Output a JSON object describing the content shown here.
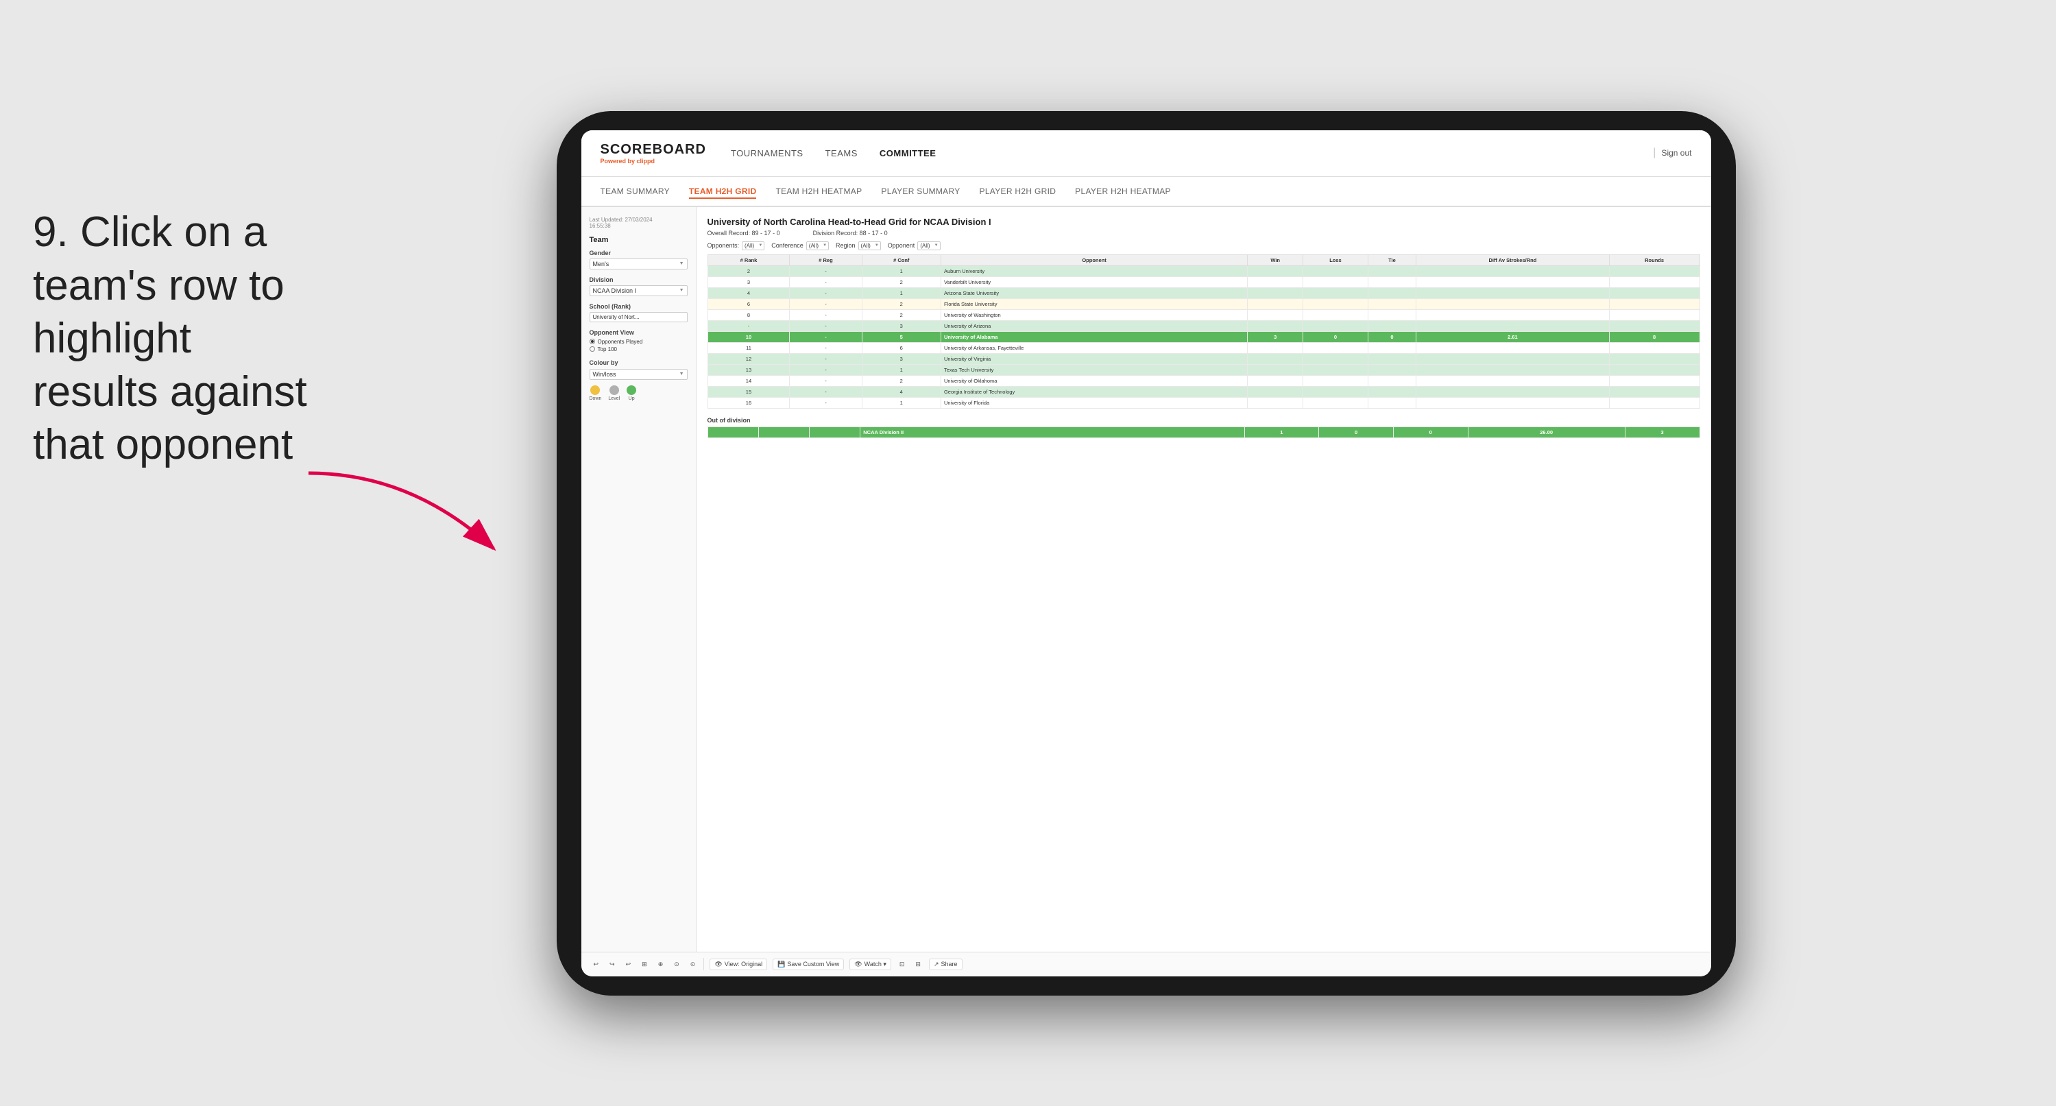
{
  "instruction": {
    "step": "9.",
    "text": "Click on a team's row to highlight results against that opponent"
  },
  "nav": {
    "logo": "SCOREBOARD",
    "powered_by": "Powered by",
    "brand": "clippd",
    "links": [
      "TOURNAMENTS",
      "TEAMS",
      "COMMITTEE"
    ],
    "active_link": "COMMITTEE",
    "sign_out": "Sign out"
  },
  "sub_nav": {
    "links": [
      "TEAM SUMMARY",
      "TEAM H2H GRID",
      "TEAM H2H HEATMAP",
      "PLAYER SUMMARY",
      "PLAYER H2H GRID",
      "PLAYER H2H HEATMAP"
    ],
    "active": "TEAM H2H GRID"
  },
  "sidebar": {
    "last_updated_label": "Last Updated: 27/03/2024",
    "last_updated_time": "16:55:38",
    "team_label": "Team",
    "gender_label": "Gender",
    "gender_value": "Men's",
    "division_label": "Division",
    "division_value": "NCAA Division I",
    "school_label": "School (Rank)",
    "school_value": "University of Nort...",
    "opponent_view_label": "Opponent View",
    "opponent_options": [
      "Opponents Played",
      "Top 100"
    ],
    "opponent_selected": "Opponents Played",
    "colour_by_label": "Colour by",
    "colour_by_value": "Win/loss",
    "legend": [
      {
        "label": "Down",
        "color": "#f0c040"
      },
      {
        "label": "Level",
        "color": "#b0b0b0"
      },
      {
        "label": "Up",
        "color": "#5cb85c"
      }
    ]
  },
  "grid": {
    "title": "University of North Carolina Head-to-Head Grid for NCAA Division I",
    "overall_record_label": "Overall Record:",
    "overall_record": "89 - 17 - 0",
    "division_record_label": "Division Record:",
    "division_record": "88 - 17 - 0",
    "filters": {
      "opponents_label": "Opponents:",
      "opponents_value": "(All)",
      "conference_label": "Conference",
      "conference_value": "(All)",
      "region_label": "Region",
      "region_value": "(All)",
      "opponent_label": "Opponent",
      "opponent_value": "(All)"
    },
    "columns": [
      "# Rank",
      "# Reg",
      "# Conf",
      "Opponent",
      "Win",
      "Loss",
      "Tie",
      "Diff Av Strokes/Rnd",
      "Rounds"
    ],
    "rows": [
      {
        "rank": "2",
        "reg": "-",
        "conf": "1",
        "opponent": "Auburn University",
        "win": "",
        "loss": "",
        "tie": "",
        "diff": "",
        "rounds": "",
        "color": "light-green"
      },
      {
        "rank": "3",
        "reg": "-",
        "conf": "2",
        "opponent": "Vanderbilt University",
        "win": "",
        "loss": "",
        "tie": "",
        "diff": "",
        "rounds": "",
        "color": ""
      },
      {
        "rank": "4",
        "reg": "-",
        "conf": "1",
        "opponent": "Arizona State University",
        "win": "",
        "loss": "",
        "tie": "",
        "diff": "",
        "rounds": "",
        "color": "light-green"
      },
      {
        "rank": "6",
        "reg": "-",
        "conf": "2",
        "opponent": "Florida State University",
        "win": "",
        "loss": "",
        "tie": "",
        "diff": "",
        "rounds": "",
        "color": "light-yellow"
      },
      {
        "rank": "8",
        "reg": "-",
        "conf": "2",
        "opponent": "University of Washington",
        "win": "",
        "loss": "",
        "tie": "",
        "diff": "",
        "rounds": "",
        "color": ""
      },
      {
        "rank": "-",
        "reg": "-",
        "conf": "3",
        "opponent": "University of Arizona",
        "win": "",
        "loss": "",
        "tie": "",
        "diff": "",
        "rounds": "",
        "color": "light-green"
      },
      {
        "rank": "10",
        "reg": "-",
        "conf": "5",
        "opponent": "University of Alabama",
        "win": "3",
        "loss": "0",
        "tie": "0",
        "diff": "2.61",
        "rounds": "8",
        "color": "highlighted"
      },
      {
        "rank": "11",
        "reg": "-",
        "conf": "6",
        "opponent": "University of Arkansas, Fayetteville",
        "win": "",
        "loss": "",
        "tie": "",
        "diff": "",
        "rounds": "",
        "color": ""
      },
      {
        "rank": "12",
        "reg": "-",
        "conf": "3",
        "opponent": "University of Virginia",
        "win": "",
        "loss": "",
        "tie": "",
        "diff": "",
        "rounds": "",
        "color": "light-green"
      },
      {
        "rank": "13",
        "reg": "-",
        "conf": "1",
        "opponent": "Texas Tech University",
        "win": "",
        "loss": "",
        "tie": "",
        "diff": "",
        "rounds": "",
        "color": "light-green"
      },
      {
        "rank": "14",
        "reg": "-",
        "conf": "2",
        "opponent": "University of Oklahoma",
        "win": "",
        "loss": "",
        "tie": "",
        "diff": "",
        "rounds": "",
        "color": ""
      },
      {
        "rank": "15",
        "reg": "-",
        "conf": "4",
        "opponent": "Georgia Institute of Technology",
        "win": "",
        "loss": "",
        "tie": "",
        "diff": "",
        "rounds": "",
        "color": "light-green"
      },
      {
        "rank": "16",
        "reg": "-",
        "conf": "1",
        "opponent": "University of Florida",
        "win": "",
        "loss": "",
        "tie": "",
        "diff": "",
        "rounds": "",
        "color": ""
      }
    ],
    "out_of_division_label": "Out of division",
    "out_of_division_row": {
      "division": "NCAA Division II",
      "win": "1",
      "loss": "0",
      "tie": "0",
      "diff": "26.00",
      "rounds": "3"
    }
  },
  "toolbar": {
    "buttons": [
      "↩",
      "↪",
      "↩",
      "⊞",
      "⊕",
      "⊙",
      "⊙"
    ],
    "view_label": "View: Original",
    "save_custom": "Save Custom View",
    "watch": "Watch ▾",
    "share": "Share"
  }
}
